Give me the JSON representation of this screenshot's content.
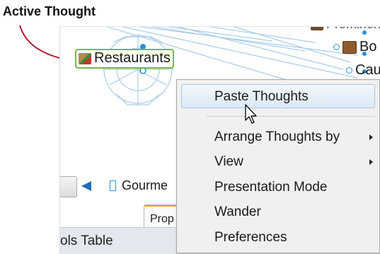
{
  "annotation": {
    "label": "Active Thought"
  },
  "map": {
    "active_thought": "Restaurants",
    "nodes": {
      "top_label": "Prominent",
      "bo_label": "Bo",
      "caus_label": "Caus",
      "gourmet_label": "Gourme"
    }
  },
  "tabs": {
    "properties_tab": "Prop"
  },
  "bottom": {
    "partial_label": "ols  Table"
  },
  "context_menu": {
    "items": [
      {
        "label": "Paste Thoughts",
        "highlighted": true,
        "submenu": false
      },
      {
        "label": "Arrange Thoughts by",
        "highlighted": false,
        "submenu": true
      },
      {
        "label": "View",
        "highlighted": false,
        "submenu": true
      },
      {
        "label": "Presentation Mode",
        "highlighted": false,
        "submenu": false
      },
      {
        "label": "Wander",
        "highlighted": false,
        "submenu": false
      },
      {
        "label": "Preferences",
        "highlighted": false,
        "submenu": false
      }
    ]
  },
  "colors": {
    "accent_blue": "#2a90d8",
    "annotation_arrow": "#b0182a",
    "active_border": "#7ab648",
    "tab_accent": "#f0a028"
  }
}
